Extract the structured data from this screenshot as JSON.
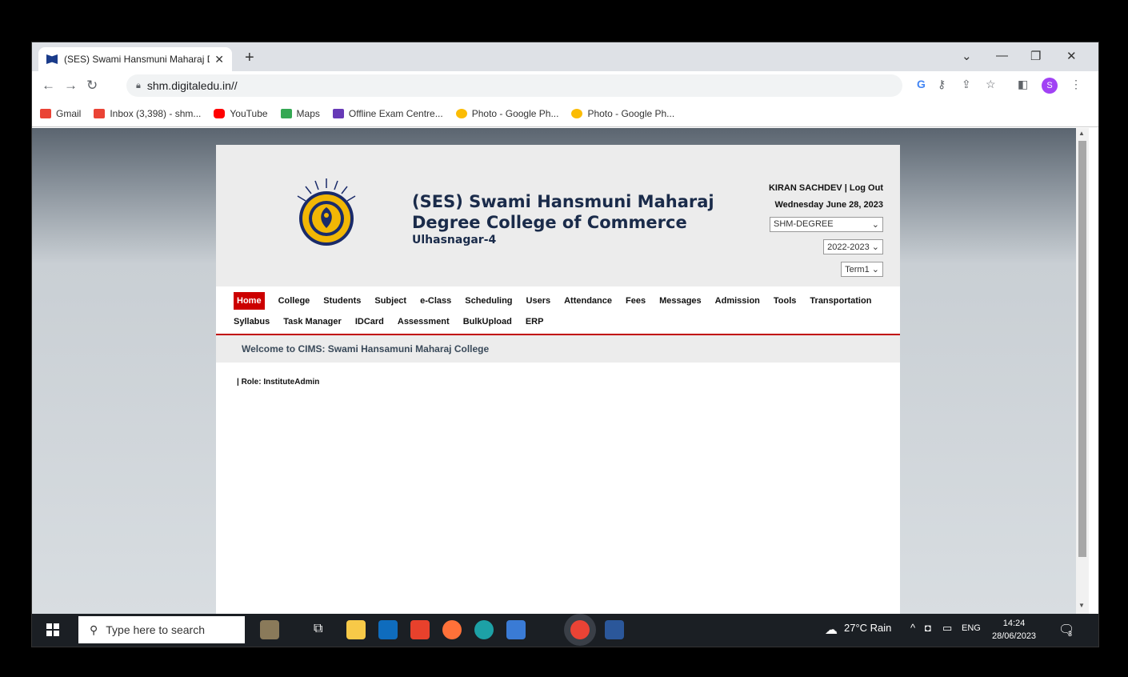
{
  "browser": {
    "tab_title": "(SES) Swami Hansmuni Maharaj D",
    "url": "shm.digitaledu.in//",
    "bookmarks": [
      {
        "label": "Gmail",
        "color": "#ea4335"
      },
      {
        "label": "Inbox (3,398) - shm...",
        "color": "#ea4335"
      },
      {
        "label": "YouTube",
        "color": "#ff0000"
      },
      {
        "label": "Maps",
        "color": "#34a853"
      },
      {
        "label": "Offline Exam Centre...",
        "color": "#673ab7"
      },
      {
        "label": "Photo - Google Ph...",
        "color": "#fbbc04"
      },
      {
        "label": "Photo - Google Ph...",
        "color": "#fbbc04"
      }
    ],
    "avatar_letter": "S"
  },
  "college": {
    "line1": "(SES) Swami Hansmuni Maharaj",
    "line2": "Degree College of Commerce",
    "line3": "Ulhasnagar-4"
  },
  "user": {
    "name": "KIRAN SACHDEV |",
    "logout": "Log Out",
    "date": "Wednesday June 28, 2023",
    "institute_select": "SHM-DEGREE",
    "year_select": "2022-2023",
    "term_select": "Term1"
  },
  "menu": {
    "row1": [
      "Home",
      "College",
      "Students",
      "Subject",
      "e-Class",
      "Scheduling",
      "Users",
      "Attendance",
      "Fees",
      "Messages",
      "Admission",
      "Tools",
      "Transportation"
    ],
    "row2": [
      "Syllabus",
      "Task Manager",
      "IDCard",
      "Assessment",
      "BulkUpload",
      "ERP"
    ]
  },
  "welcome": "Welcome to CIMS: Swami Hansamuni Maharaj College",
  "role": "| Role: InstituteAdmin",
  "taskbar": {
    "search_placeholder": "Type here to search",
    "weather": "27°C Rain",
    "lang": "ENG",
    "time": "14:24",
    "date": "28/06/2023",
    "notif_count": "3"
  }
}
